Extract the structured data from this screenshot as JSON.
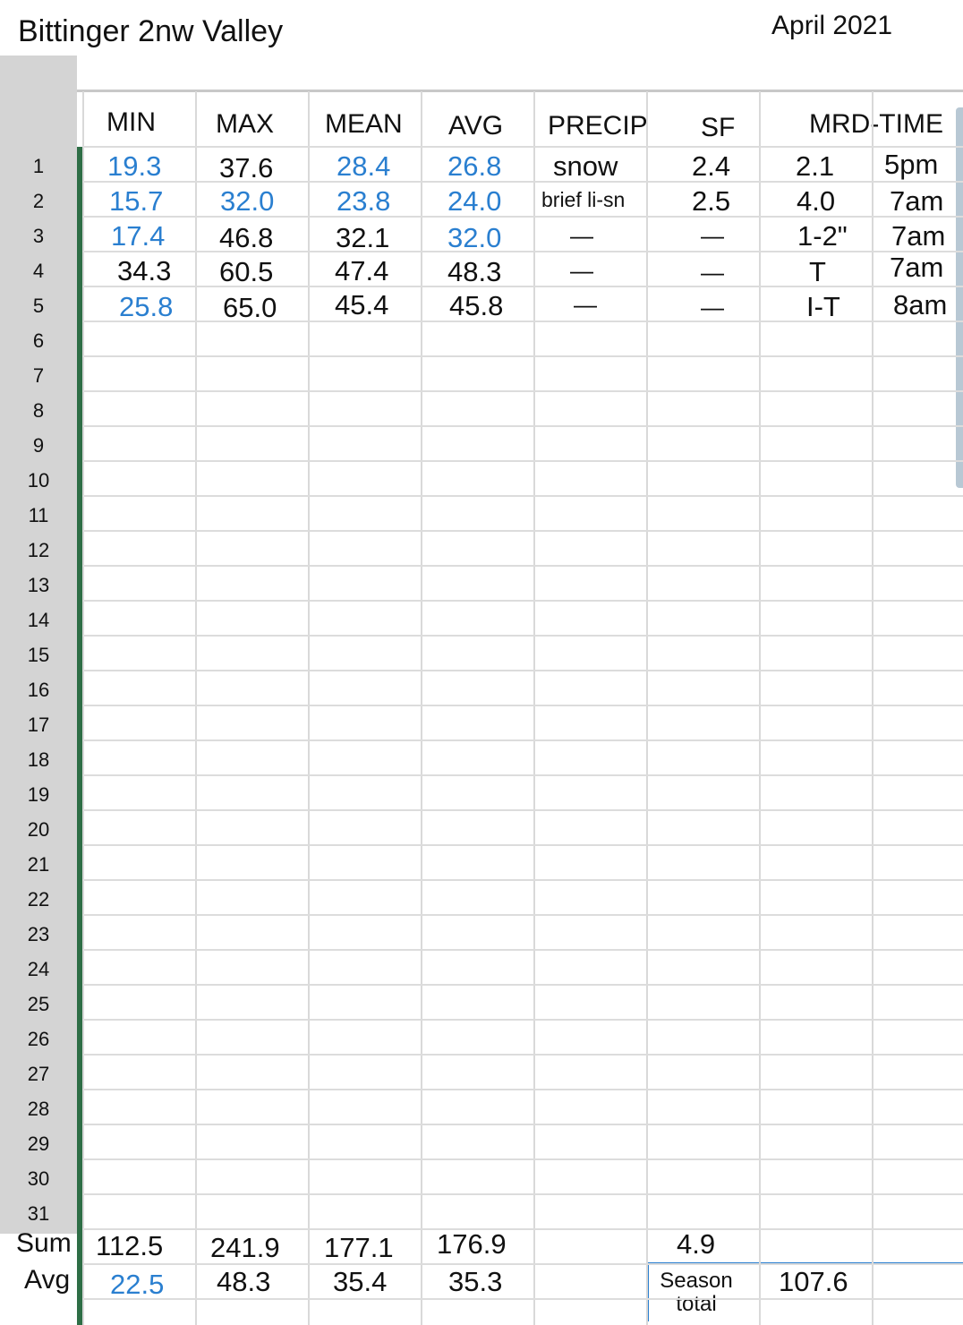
{
  "header": {
    "title": "Bittinger 2nw Valley",
    "month": "April 2021"
  },
  "columns": [
    "MIN",
    "MAX",
    "MEAN",
    "AVG",
    "PRECIP",
    "SF",
    "MRD-TIME"
  ],
  "row_numbers": [
    "1",
    "2",
    "3",
    "4",
    "5",
    "6",
    "7",
    "8",
    "9",
    "10",
    "11",
    "12",
    "13",
    "14",
    "15",
    "16",
    "17",
    "18",
    "19",
    "20",
    "21",
    "22",
    "23",
    "24",
    "25",
    "26",
    "27",
    "28",
    "29",
    "30",
    "31"
  ],
  "rows": [
    {
      "min": "19.3",
      "max": "37.6",
      "mean": "28.4",
      "avg": "26.8",
      "precip": "snow",
      "sf": "2.4",
      "mrd": "2.1",
      "time": "5pm"
    },
    {
      "min": "15.7",
      "max": "32.0",
      "mean": "23.8",
      "avg": "24.0",
      "precip": "brief li-sn",
      "sf": "2.5",
      "mrd": "4.0",
      "time": "7am"
    },
    {
      "min": "17.4",
      "max": "46.8",
      "mean": "32.1",
      "avg": "32.0",
      "precip": "—",
      "sf": "—",
      "mrd": "1-2\"",
      "time": "7am"
    },
    {
      "min": "34.3",
      "max": "60.5",
      "mean": "47.4",
      "avg": "48.3",
      "precip": "—",
      "sf": "—",
      "mrd": "T",
      "time": "7am"
    },
    {
      "min": "25.8",
      "max": "65.0",
      "mean": "45.4",
      "avg": "45.8",
      "precip": "—",
      "sf": "—",
      "mrd": "I-T",
      "time": "8am"
    }
  ],
  "summary": {
    "sum_label": "Sum",
    "avg_label": "Avg",
    "sum": {
      "min": "112.5",
      "max": "241.9",
      "mean": "177.1",
      "avg": "176.9",
      "sf": "4.9"
    },
    "avg": {
      "min": "22.5",
      "max": "48.3",
      "mean": "35.4",
      "avg": "35.3"
    },
    "season_label_1": "Season",
    "season_label_2": "total",
    "season_total": "107.6"
  },
  "colors": {
    "blue_values": "#2a7fd0",
    "green_bar": "#2e6e46",
    "row_header_bg": "#d4d4d4"
  }
}
